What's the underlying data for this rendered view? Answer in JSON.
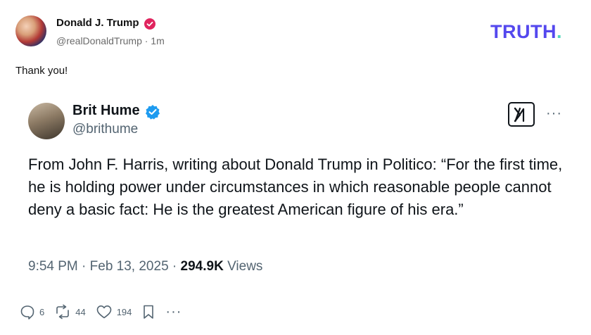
{
  "truth_post": {
    "author_name": "Donald J. Trump",
    "handle_line": "@realDonaldTrump · 1m",
    "brand": "TRUTH",
    "brand_dot": ".",
    "message": "Thank you!"
  },
  "x_post": {
    "author_name": "Brit Hume",
    "handle": "@brithume",
    "body": "From John F. Harris, writing about Donald Trump in Politico: “For the first time, he is holding power under circumstances in which reasonable people cannot deny a basic fact: He is the greatest American figure of his era.”",
    "time": "9:54 PM",
    "date": "Feb 13, 2025",
    "views_count": "294.9K",
    "views_label": "Views"
  },
  "actions": {
    "replies": "6",
    "retruths": "44",
    "likes": "194"
  },
  "colors": {
    "truth_brand": "#5448ee",
    "truth_dot": "#55d7ba",
    "verified_truth": "#e0245e",
    "verified_x": "#1d9bf0",
    "muted_text": "#536471"
  },
  "icons": [
    "verified-badge-icon",
    "x-logo-icon",
    "more-options-icon",
    "reply-icon",
    "retruth-icon",
    "like-icon",
    "bookmark-icon"
  ]
}
